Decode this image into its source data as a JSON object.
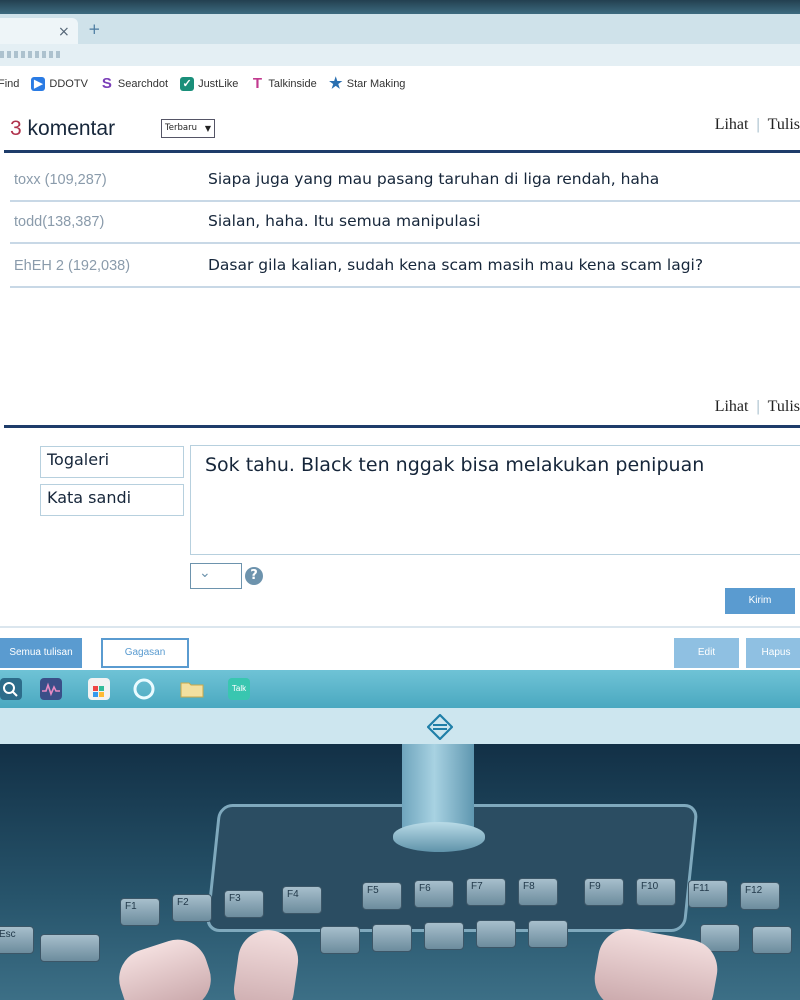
{
  "browser": {
    "tab_close": "×",
    "tab_new": "+",
    "bookmarks": [
      {
        "label": "Find",
        "icon": "search-icon",
        "color": ""
      },
      {
        "label": "DDOTV",
        "icon": "tv-icon",
        "color": "#2a7be4"
      },
      {
        "label": "Searchdot",
        "icon": "s-logo-icon",
        "color": "#7a3db8"
      },
      {
        "label": "JustLike",
        "icon": "bookmark-icon",
        "color": "#1a8f7a"
      },
      {
        "label": "Talkinside",
        "icon": "t-logo-icon",
        "color": "#c23a8f"
      },
      {
        "label": "Star Making",
        "icon": "star-icon",
        "color": "#2a6fb0"
      }
    ]
  },
  "comments": {
    "count": "3",
    "count_label": "komentar",
    "sort_label": "Terbaru",
    "view_link": "Lihat",
    "write_link": "Tulis",
    "separator": "|",
    "items": [
      {
        "user": "toxx  (109,287)",
        "text": "Siapa juga yang mau pasang taruhan di liga rendah, haha"
      },
      {
        "user": "todd(138,387)",
        "text": "Sialan, haha. Itu semua manipulasi"
      },
      {
        "user": "EhEH 2 (192,038)",
        "text": "Dasar gila kalian, sudah kena scam masih mau kena scam lagi?"
      }
    ]
  },
  "form": {
    "view_link": "Lihat",
    "write_link": "Tulis",
    "separator": "|",
    "name_field": "Togaleri",
    "password_field": "Kata sandi",
    "message": "Sok tahu. Black ten nggak bisa melakukan penipuan",
    "captcha_value": "⌄",
    "help": "?",
    "submit_label": "Kirim"
  },
  "toolbar": {
    "all_posts": "Semua tulisan",
    "ideas": "Gagasan",
    "edit": "Edit",
    "delete": "Hapus"
  },
  "taskbar": {
    "talk_label": "Talk"
  },
  "keyboard": {
    "keys": [
      "Esc",
      "F1",
      "F2",
      "F3",
      "F4",
      "F5",
      "F6",
      "F7",
      "F8",
      "F9",
      "F10",
      "F11",
      "F12"
    ]
  },
  "colors": {
    "accent": "#5a9bd0",
    "count_red": "#b0324c",
    "rule_navy": "#1e3c6a",
    "taskbar": "#5ab7cc"
  }
}
